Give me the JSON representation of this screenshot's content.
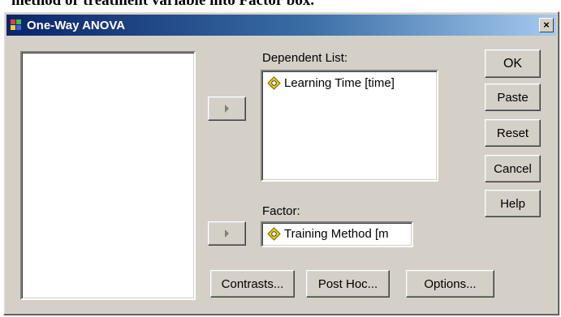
{
  "caption": "method or treatment variable into Factor box.",
  "dialog": {
    "title": "One-Way ANOVA",
    "close_glyph": "×"
  },
  "dependent_list": {
    "label": "Dependent List:",
    "items": [
      {
        "label": "Learning Time [time]",
        "icon": "scale-variable-icon"
      }
    ]
  },
  "factor": {
    "label": "Factor:",
    "value": "Training Method [m",
    "icon": "scale-variable-icon"
  },
  "side_buttons": {
    "ok": "OK",
    "paste": "Paste",
    "reset": "Reset",
    "cancel": "Cancel",
    "help": "Help"
  },
  "bottom_buttons": {
    "contrasts": "Contrasts...",
    "post_hoc": "Post Hoc...",
    "options": "Options..."
  },
  "colors": {
    "title_gradient_start": "#0a246a",
    "title_gradient_end": "#a6caf0",
    "dialog_face": "#d4d0c8",
    "variable_icon": "#e8d400"
  }
}
